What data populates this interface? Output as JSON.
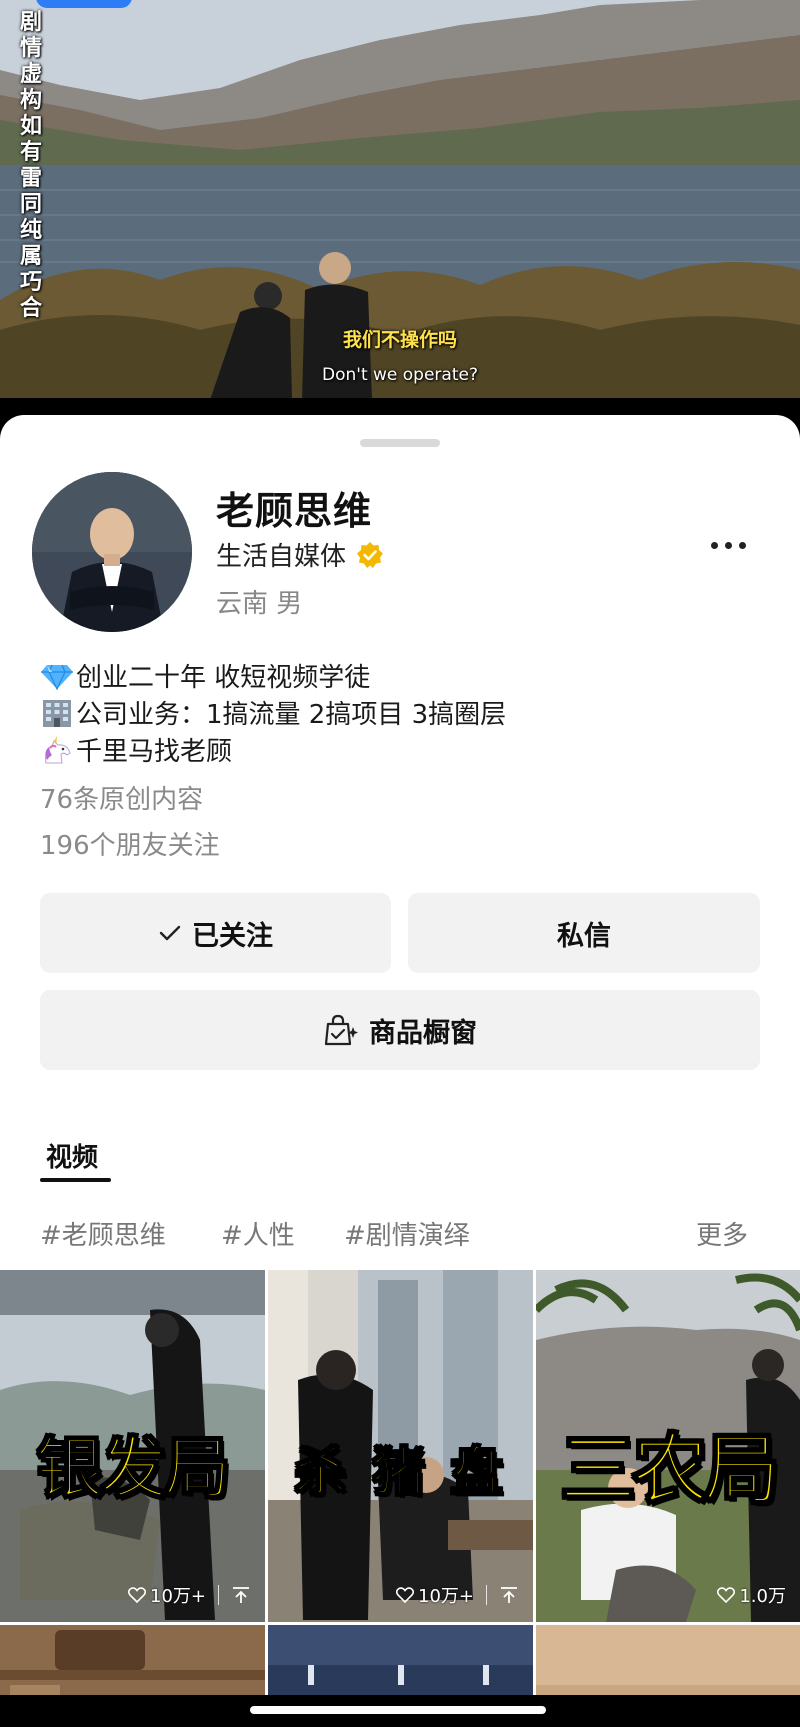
{
  "video": {
    "side_notice": "剧情虚构 如有雷同 纯属巧合",
    "subtitle_cn": "我们不操作吗",
    "subtitle_en": "Don't we operate?"
  },
  "profile": {
    "name": "老顾思维",
    "tag": "生活自媒体",
    "location_gender": "云南 男",
    "more_icon": "more-dots-icon",
    "bio": [
      {
        "icon": "diamond-emoji",
        "text": "创业二十年 收短视频学徒"
      },
      {
        "icon": "office-building-emoji",
        "text": "公司业务：1搞流量 2搞项目 3搞圈层"
      },
      {
        "icon": "unicorn-emoji",
        "text": "千里马找老顾"
      }
    ],
    "original_count": "76条原创内容",
    "friends_follow": "196个朋友关注"
  },
  "actions": {
    "follow_label": "已关注",
    "message_label": "私信",
    "showcase_label": "商品橱窗"
  },
  "tabs": {
    "video_label": "视频"
  },
  "hashtags": {
    "items": [
      "#老顾思维",
      "#人性",
      "#剧情演绎"
    ],
    "more_label": "更多"
  },
  "grid": {
    "items": [
      {
        "title": "银发局",
        "likes": "10万+",
        "pinned": true
      },
      {
        "title": "杀 猪 盘",
        "likes": "10万+",
        "pinned": true
      },
      {
        "title": "三农局",
        "likes": "1.0万",
        "pinned": false
      }
    ]
  },
  "colors": {
    "accent_blue": "#2f7df6",
    "verified_badge": "#f5b800",
    "cover_title": "#ffe600"
  }
}
